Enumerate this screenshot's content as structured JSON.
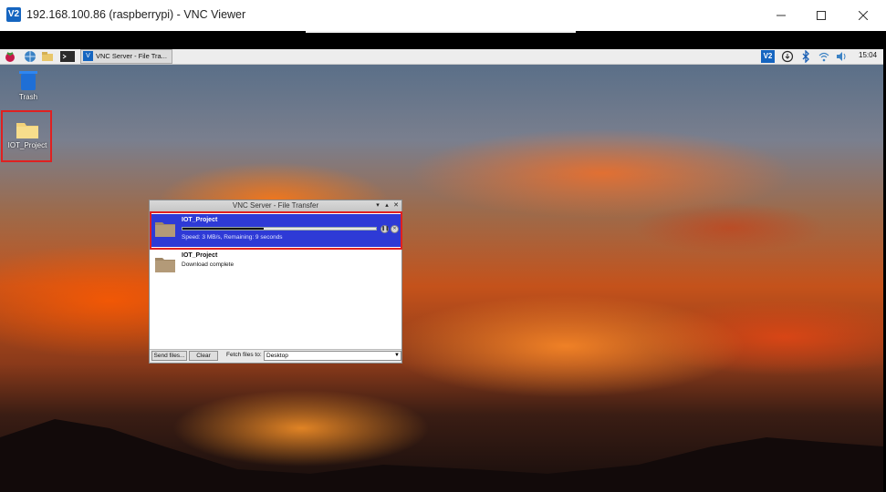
{
  "window": {
    "title": "192.168.100.86 (raspberrypi) - VNC Viewer",
    "app_icon": "vnc-viewer-logo",
    "logo_text": "V2"
  },
  "panel": {
    "taskbar_item": "VNC Server - File Tra...",
    "clock": "15:04",
    "tray_vnc_text": "V2"
  },
  "desktop_icons": {
    "trash_label": "Trash",
    "project_label": "IOT_Project"
  },
  "dialog": {
    "title": "VNC Server - File Transfer",
    "items": [
      {
        "name": "IOT_Project",
        "status": "Speed: 3 MB/s, Remaining: 9 seconds",
        "progress": 0.42
      },
      {
        "name": "IOT_Project",
        "status": "Download complete"
      }
    ],
    "send_button": "Send files...",
    "clear_button": "Clear",
    "fetch_label": "Fetch files to:",
    "fetch_value": "Desktop"
  },
  "colors": {
    "selection": "#2e3ad6",
    "highlight": "#e02020",
    "vnc_brand": "#1565c0"
  }
}
